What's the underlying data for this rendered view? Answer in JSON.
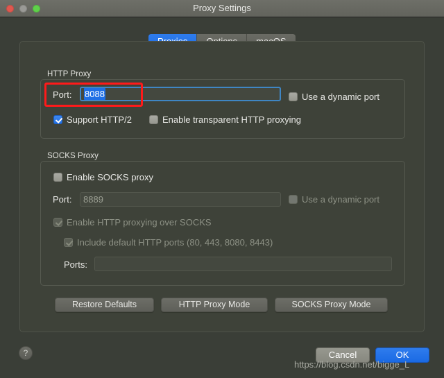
{
  "window": {
    "title": "Proxy Settings",
    "traffic_lights": [
      "close-light",
      "minimize-light",
      "zoom-light"
    ]
  },
  "tabs": [
    {
      "label": "Proxies",
      "active": true
    },
    {
      "label": "Options",
      "active": false
    },
    {
      "label": "macOS",
      "active": false
    }
  ],
  "http_proxy": {
    "group_label": "HTTP Proxy",
    "port_label": "Port:",
    "port_value": "8088",
    "port_focused": true,
    "port_selected": true,
    "dynamic_port_label": "Use a dynamic port",
    "dynamic_port_checked": false,
    "support_http2_label": "Support HTTP/2",
    "support_http2_checked": true,
    "transparent_label": "Enable transparent HTTP proxying",
    "transparent_checked": false
  },
  "socks_proxy": {
    "group_label": "SOCKS Proxy",
    "enable_label": "Enable SOCKS proxy",
    "enable_checked": false,
    "port_label": "Port:",
    "port_value": "8889",
    "dynamic_port_label": "Use a dynamic port",
    "dynamic_port_checked": false,
    "http_over_socks_label": "Enable HTTP proxying over SOCKS",
    "http_over_socks_checked": true,
    "include_default_label": "Include default HTTP ports (80, 443, 8080, 8443)",
    "include_default_checked": true,
    "ports_label": "Ports:",
    "ports_value": ""
  },
  "mode_buttons": [
    {
      "label": "Restore Defaults"
    },
    {
      "label": "HTTP Proxy Mode"
    },
    {
      "label": "SOCKS Proxy Mode"
    }
  ],
  "footer": {
    "help_label": "?",
    "cancel_label": "Cancel",
    "ok_label": "OK"
  },
  "watermark": {
    "text": "https://blog.csdn.net/bigge_L"
  },
  "colors": {
    "accent_blue": "#1f6fe5",
    "window_bg": "#3a3e37",
    "panel_bg": "#3e4239",
    "titlebar": "#65665f",
    "annotation_red": "#ff1a1a",
    "text": "#e9e9e6",
    "text_disabled": "#8d9185"
  }
}
